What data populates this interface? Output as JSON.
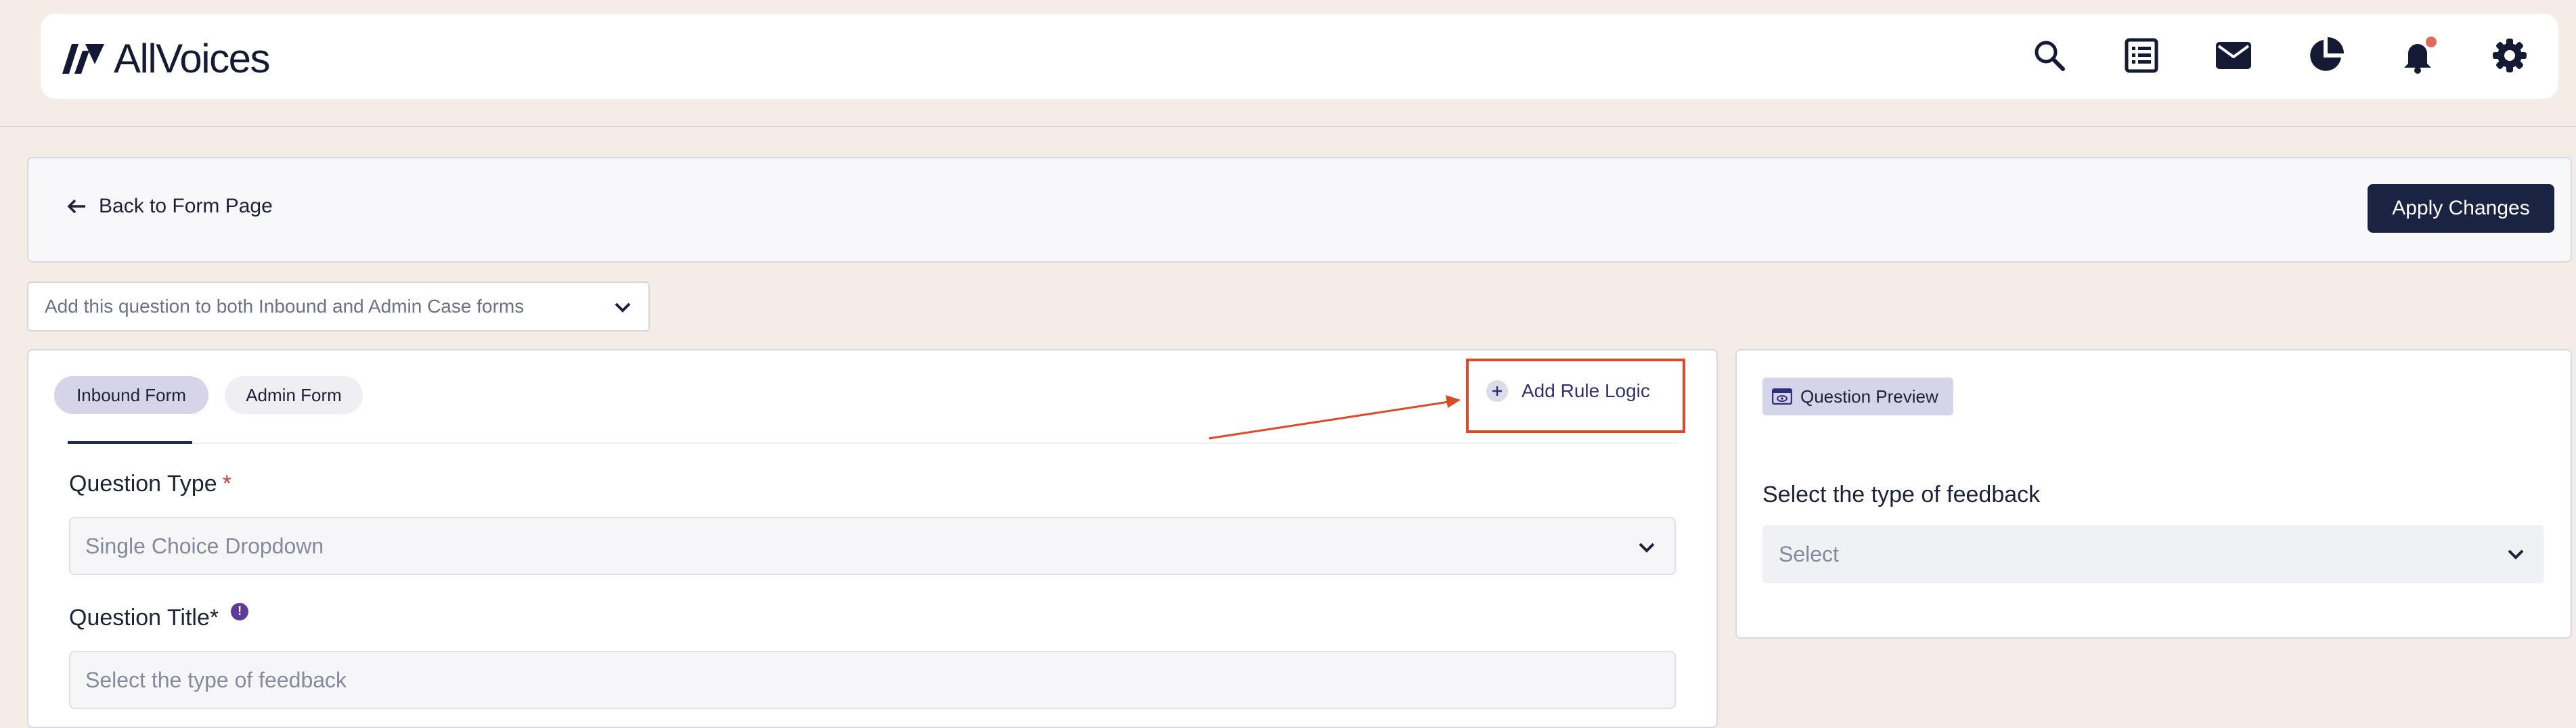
{
  "header": {
    "brand": "AllVoices",
    "icons": [
      "search-icon",
      "list-icon",
      "mail-icon",
      "pie-chart-icon",
      "bell-icon",
      "gear-icon"
    ],
    "notification_dot_color": "#e06b5c"
  },
  "toolbar": {
    "back_label": "Back to Form Page",
    "apply_label": "Apply Changes"
  },
  "form_scope": {
    "selected": "Add this question to both Inbound and Admin Case forms"
  },
  "tabs": [
    {
      "label": "Inbound Form",
      "active": true
    },
    {
      "label": "Admin Form",
      "active": false
    }
  ],
  "rule_logic": {
    "label": "Add Rule Logic",
    "highlight_color": "#dd4a27"
  },
  "fields": {
    "question_type": {
      "label": "Question Type",
      "required_mark": "*",
      "value": "Single Choice Dropdown"
    },
    "question_title": {
      "label": "Question Title*",
      "info_mark": "!",
      "value": "Select the type of feedback"
    }
  },
  "preview": {
    "badge": "Question Preview",
    "question": "Select the type of feedback",
    "placeholder": "Select"
  }
}
